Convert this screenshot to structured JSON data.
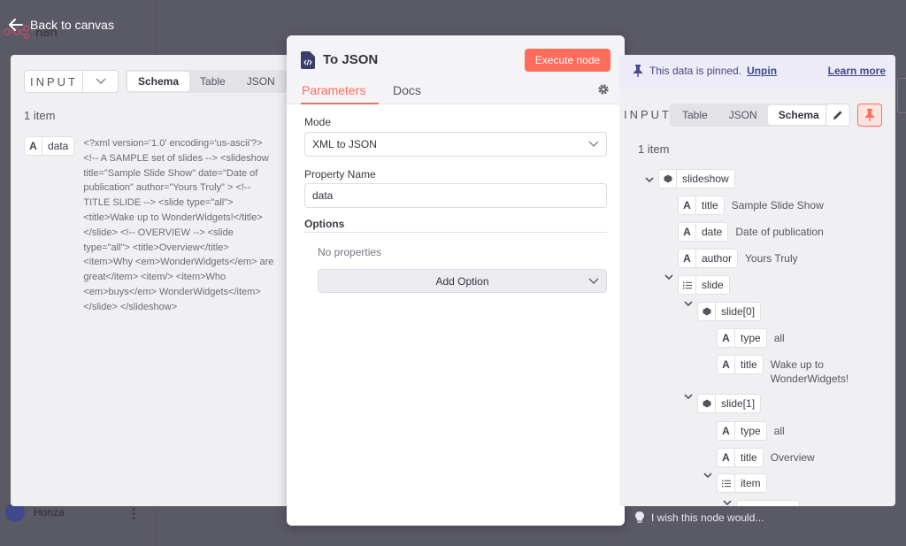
{
  "app": {
    "brand": "n8n",
    "back_label": "Back to canvas",
    "user_name": "Honza",
    "user_menu_glyph": "⋮",
    "feedback_label": "I wish this node would..."
  },
  "input_panel": {
    "selector_label": "INPUT",
    "view_tabs": [
      {
        "label": "Schema",
        "active": true
      },
      {
        "label": "Table",
        "active": false
      },
      {
        "label": "JSON",
        "active": false
      }
    ],
    "item_count": "1 item",
    "field": {
      "type_glyph": "A",
      "name": "data",
      "value": "<?xml version='1.0' encoding='us-ascii'?> <!-- A SAMPLE set of slides --> <slideshow title=\"Sample Slide Show\" date=\"Date of publication\" author=\"Yours Truly\" > <!-- TITLE SLIDE --> <slide type=\"all\"> <title>Wake up to WonderWidgets!</title> </slide> <!-- OVERVIEW --> <slide type=\"all\"> <title>Overview</title> <item>Why <em>WonderWidgets</em> are great</item> <item/> <item>Who <em>buys</em> WonderWidgets</item> </slide> </slideshow>"
    }
  },
  "node": {
    "title": "To JSON",
    "execute_label": "Execute node",
    "tabs": [
      {
        "label": "Parameters",
        "active": true
      },
      {
        "label": "Docs",
        "active": false
      }
    ],
    "mode_label": "Mode",
    "mode_value": "XML to JSON",
    "property_name_label": "Property Name",
    "property_name_value": "data",
    "options_title": "Options",
    "no_properties": "No properties",
    "add_option_label": "Add Option"
  },
  "output_panel": {
    "pinned_text": "This data is pinned.",
    "unpin_label": "Unpin",
    "learn_more_label": "Learn more",
    "selector_label": "INPUT",
    "view_tabs": [
      {
        "label": "Table",
        "active": false
      },
      {
        "label": "JSON",
        "active": false
      },
      {
        "label": "Schema",
        "active": true
      }
    ],
    "item_count": "1 item",
    "tree": {
      "slideshow": {
        "name": "slideshow"
      },
      "title": {
        "glyph": "A",
        "name": "title",
        "value": "Sample Slide Show"
      },
      "date": {
        "glyph": "A",
        "name": "date",
        "value": "Date of publication"
      },
      "author": {
        "glyph": "A",
        "name": "author",
        "value": "Yours Truly"
      },
      "slide": {
        "name": "slide"
      },
      "slide0": {
        "name": "slide[0]"
      },
      "slide0_type": {
        "glyph": "A",
        "name": "type",
        "value": "all"
      },
      "slide0_title": {
        "glyph": "A",
        "name": "title",
        "value": "Wake up to WonderWidgets!"
      },
      "slide1": {
        "name": "slide[1]"
      },
      "slide1_type": {
        "glyph": "A",
        "name": "type",
        "value": "all"
      },
      "slide1_title": {
        "glyph": "A",
        "name": "title",
        "value": "Overview"
      },
      "item": {
        "name": "item"
      }
    }
  },
  "colors": {
    "accent": "#ff6d5a",
    "link": "#3f4a8a",
    "panel_bg": "#f0f0f3"
  },
  "icons": [
    "arrow-left-icon",
    "n8n-logo-icon",
    "code-file-icon",
    "gear-icon",
    "chevron-down-icon",
    "pin-icon",
    "pencil-icon",
    "object-icon",
    "list-icon",
    "text-type-icon",
    "lightbulb-icon",
    "kebab-menu-icon"
  ]
}
